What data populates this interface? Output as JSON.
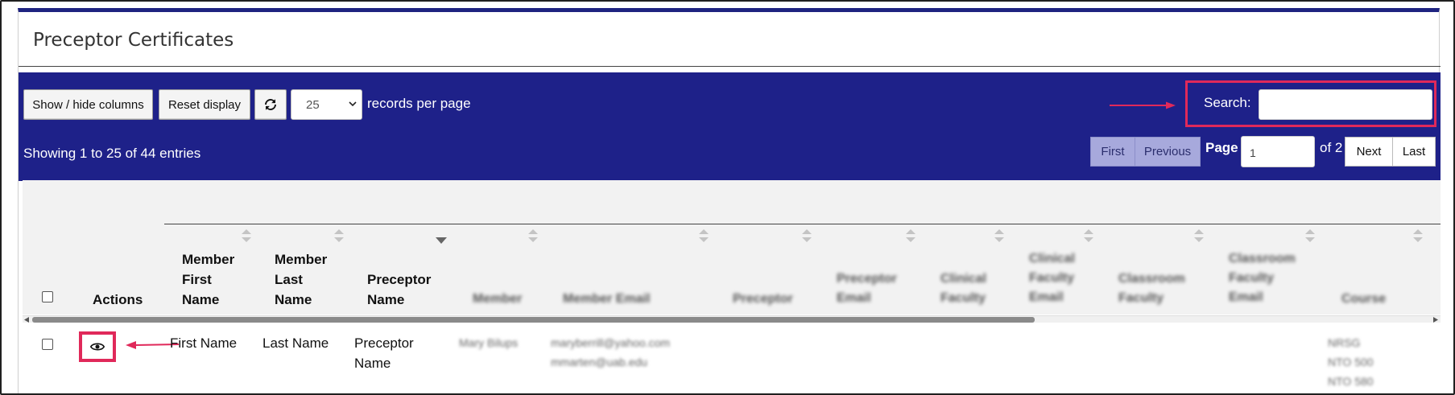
{
  "page": {
    "title": "Preceptor Certificates"
  },
  "toolbar": {
    "show_hide_label": "Show / hide columns",
    "reset_label": "Reset display",
    "page_size_value": "25",
    "records_per_page_label": "records per page",
    "search_label": "Search:",
    "search_value": ""
  },
  "info": {
    "showing_text": "Showing 1 to 25 of 44 entries"
  },
  "pagination": {
    "first_label": "First",
    "previous_label": "Previous",
    "page_label": "Page",
    "page_value": "1",
    "of_label": "of 2",
    "next_label": "Next",
    "last_label": "Last"
  },
  "table": {
    "columns": {
      "actions": "Actions",
      "member_first_name": [
        "Member",
        "First",
        "Name"
      ],
      "member_last_name": [
        "Member",
        "Last",
        "Name"
      ],
      "preceptor_name": [
        "Preceptor",
        "Name"
      ],
      "member": "Member",
      "member_email": "Member Email",
      "preceptor": "Preceptor",
      "preceptor_email": [
        "Preceptor",
        "Email"
      ],
      "clinical_faculty": [
        "Clinical",
        "Faculty"
      ],
      "clinical_faculty_email": [
        "Clinical",
        "Faculty",
        "Email"
      ],
      "classroom_faculty": [
        "Classroom",
        "Faculty"
      ],
      "classroom_faculty_email": [
        "Classroom",
        "Faculty",
        "Email"
      ],
      "course": "Course"
    },
    "rows": [
      {
        "first_name": "First Name",
        "last_name": "Last Name",
        "preceptor_name": [
          "Preceptor",
          "Name"
        ],
        "member": "Mary Bilups",
        "member_email": [
          "maryberrill@yahoo.com",
          "mmarten@uab.edu"
        ],
        "course": [
          "NRSG",
          "NTO 500",
          "NTO 580"
        ]
      }
    ]
  },
  "colors": {
    "panel": "#1e2189",
    "accent": "#e0295a",
    "pager_active": "#a7a9dc"
  },
  "icons": [
    "refresh-icon",
    "chevron-down-icon",
    "eye-icon",
    "sort-icon"
  ]
}
